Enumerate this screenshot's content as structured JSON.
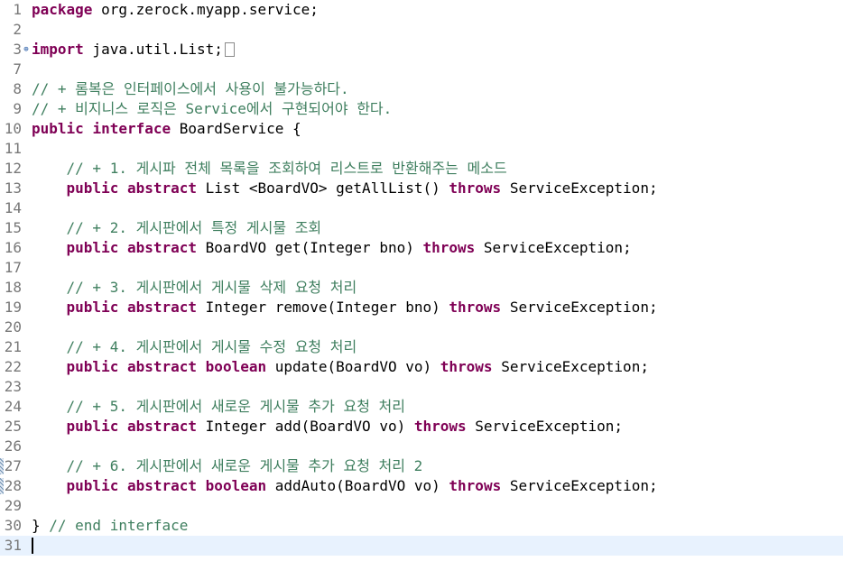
{
  "editor": {
    "current_line": 31,
    "lines": [
      {
        "n": "1",
        "parts": [
          {
            "t": "package",
            "c": "kw"
          },
          {
            "t": " org.zerock.myapp.service;"
          }
        ]
      },
      {
        "n": "2",
        "parts": []
      },
      {
        "n": "3",
        "fold": "⊕",
        "parts": [
          {
            "t": "import",
            "c": "kw"
          },
          {
            "t": " java.util.List;"
          },
          {
            "box": true
          }
        ]
      },
      {
        "n": "7",
        "parts": []
      },
      {
        "n": "8",
        "parts": [
          {
            "t": "// + 롬복은 인터페이스에서 사용이 불가능하다.",
            "c": "cm"
          }
        ]
      },
      {
        "n": "9",
        "parts": [
          {
            "t": "// + 비지니스 로직은 Service에서 구현되어야 한다.",
            "c": "cm"
          }
        ]
      },
      {
        "n": "10",
        "parts": [
          {
            "t": "public",
            "c": "kw"
          },
          {
            "t": " "
          },
          {
            "t": "interface",
            "c": "kw"
          },
          {
            "t": " BoardService {"
          }
        ]
      },
      {
        "n": "11",
        "parts": []
      },
      {
        "n": "12",
        "parts": [
          {
            "t": "    "
          },
          {
            "t": "// + 1. 게시파 전체 목록을 조회하여 리스트로 반환해주는 메소드",
            "c": "cm"
          }
        ]
      },
      {
        "n": "13",
        "parts": [
          {
            "t": "    "
          },
          {
            "t": "public",
            "c": "kw"
          },
          {
            "t": " "
          },
          {
            "t": "abstract",
            "c": "kw"
          },
          {
            "t": " List <BoardVO> getAllList() "
          },
          {
            "t": "throws",
            "c": "kw"
          },
          {
            "t": " ServiceException;"
          }
        ]
      },
      {
        "n": "14",
        "parts": []
      },
      {
        "n": "15",
        "parts": [
          {
            "t": "    "
          },
          {
            "t": "// + 2. 게시판에서 특정 게시물 조회",
            "c": "cm"
          }
        ]
      },
      {
        "n": "16",
        "parts": [
          {
            "t": "    "
          },
          {
            "t": "public",
            "c": "kw"
          },
          {
            "t": " "
          },
          {
            "t": "abstract",
            "c": "kw"
          },
          {
            "t": " BoardVO get(Integer bno) "
          },
          {
            "t": "throws",
            "c": "kw"
          },
          {
            "t": " ServiceException;"
          }
        ]
      },
      {
        "n": "17",
        "parts": []
      },
      {
        "n": "18",
        "parts": [
          {
            "t": "    "
          },
          {
            "t": "// + 3. 게시판에서 게시물 삭제 요청 처리",
            "c": "cm"
          }
        ]
      },
      {
        "n": "19",
        "parts": [
          {
            "t": "    "
          },
          {
            "t": "public",
            "c": "kw"
          },
          {
            "t": " "
          },
          {
            "t": "abstract",
            "c": "kw"
          },
          {
            "t": " Integer remove(Integer bno) "
          },
          {
            "t": "throws",
            "c": "kw"
          },
          {
            "t": " ServiceException;"
          }
        ]
      },
      {
        "n": "20",
        "parts": []
      },
      {
        "n": "21",
        "parts": [
          {
            "t": "    "
          },
          {
            "t": "// + 4. 게시판에서 게시물 수정 요청 처리",
            "c": "cm"
          }
        ]
      },
      {
        "n": "22",
        "parts": [
          {
            "t": "    "
          },
          {
            "t": "public",
            "c": "kw"
          },
          {
            "t": " "
          },
          {
            "t": "abstract",
            "c": "kw"
          },
          {
            "t": " "
          },
          {
            "t": "boolean",
            "c": "kw"
          },
          {
            "t": " update(BoardVO vo) "
          },
          {
            "t": "throws",
            "c": "kw"
          },
          {
            "t": " ServiceException;"
          }
        ]
      },
      {
        "n": "23",
        "parts": []
      },
      {
        "n": "24",
        "parts": [
          {
            "t": "    "
          },
          {
            "t": "// + 5. 게시판에서 새로운 게시물 추가 요청 처리",
            "c": "cm"
          }
        ]
      },
      {
        "n": "25",
        "parts": [
          {
            "t": "    "
          },
          {
            "t": "public",
            "c": "kw"
          },
          {
            "t": " "
          },
          {
            "t": "abstract",
            "c": "kw"
          },
          {
            "t": " Integer add(BoardVO vo) "
          },
          {
            "t": "throws",
            "c": "kw"
          },
          {
            "t": " ServiceException;"
          }
        ]
      },
      {
        "n": "26",
        "parts": []
      },
      {
        "n": "27",
        "marker": true,
        "parts": [
          {
            "t": "    "
          },
          {
            "t": "// + 6. 게시판에서 새로운 게시물 추가 요청 처리 2",
            "c": "cm"
          }
        ]
      },
      {
        "n": "28",
        "marker": true,
        "parts": [
          {
            "t": "    "
          },
          {
            "t": "public",
            "c": "kw"
          },
          {
            "t": " "
          },
          {
            "t": "abstract",
            "c": "kw"
          },
          {
            "t": " "
          },
          {
            "t": "boolean",
            "c": "kw"
          },
          {
            "t": " addAuto(BoardVO vo) "
          },
          {
            "t": "throws",
            "c": "kw"
          },
          {
            "t": " ServiceException;"
          }
        ]
      },
      {
        "n": "29",
        "parts": []
      },
      {
        "n": "30",
        "parts": [
          {
            "t": "} "
          },
          {
            "t": "// end interface",
            "c": "cm"
          }
        ]
      },
      {
        "n": "31",
        "parts": [
          {
            "caret": true
          }
        ]
      }
    ]
  },
  "colors": {
    "keyword": "#7f0055",
    "comment": "#3f7f5f",
    "line_number": "#787878",
    "current_line_bg": "#e8f2fe"
  }
}
